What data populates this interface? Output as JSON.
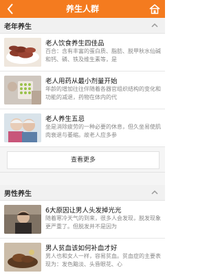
{
  "header": {
    "title": "养生人群",
    "back_icon": "chevron-left-icon",
    "home_icon": "home-icon",
    "bg": "#f47b1f"
  },
  "sections": [
    {
      "title": "老年养生",
      "items": [
        {
          "title": "老人饮食养生四佳品",
          "desc": "百合：含有丰富的蛋白质、脂肪、脱甲秋水仙碱和钙、磷、铁及维生素等，是"
        },
        {
          "title": "老人用药从最小剂量开始",
          "desc": "年龄的增加往往伴随着各器官组织结构的变化和功能的减退，药物在体内的代"
        },
        {
          "title": "老人养生五忌",
          "desc": "坐是消除疲劳的一种必要的休息，但久坐易使肌肉衰退与萎缩。故老人应多参"
        }
      ],
      "more_label": "查看更多"
    },
    {
      "title": "男性养生",
      "items": [
        {
          "title": "6大原因让男人头发掉光光",
          "desc": "随着寒冷天气的到来，很多人会发现，脱发现象更严重了。但脱发并不是因为"
        },
        {
          "title": "男人贫血该如何补血才好",
          "desc": "男人也和女人一样，容易贫血。贫血症的主要表现为：发色黯淡、头昏眼花、心"
        }
      ]
    }
  ]
}
